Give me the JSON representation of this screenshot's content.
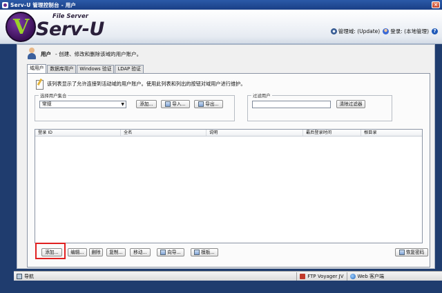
{
  "window": {
    "title": "Serv-U 管理控制台 - 用户",
    "close_label": "×"
  },
  "logo": {
    "product": "Serv-U",
    "tagline": "File Server"
  },
  "header_links": [
    {
      "label": "管理域: (Update)",
      "icon": "gear-icon"
    },
    {
      "label": "登录: (本地管理)",
      "icon": "user-icon"
    }
  ],
  "help_label": "?",
  "page": {
    "title": "用户",
    "description": "- 创建、修改和删除该域的用户账户。"
  },
  "tabs": [
    "域用户",
    "数据库用户",
    "Windows 验证",
    "LDAP 验证"
  ],
  "info_text": "该列表显示了允许连接到活动域的用户账户。使用此列表和列出的按钮对域用户进行维护。",
  "user_set": {
    "label": "选择用户集合",
    "selected": "常规",
    "add_label": "添加...",
    "import_label": "导入...",
    "export_label": "导出..."
  },
  "filter": {
    "label": "过滤用户",
    "value": "",
    "clear_label": "清除过滤器"
  },
  "table": {
    "columns": [
      "登录 ID",
      "全名",
      "说明",
      "最后登录时间",
      "根目录"
    ],
    "rows": []
  },
  "bottom_buttons": {
    "add": "添加...",
    "edit": "编辑...",
    "delete": "删除",
    "copy": "复制...",
    "move": "移动...",
    "wizard": "向导...",
    "template": "模板...",
    "restore_password": "恢复密码"
  },
  "statusbar": {
    "nav": "导航",
    "ftp": "FTP Voyager JV",
    "web": "Web 客户端"
  },
  "colors": {
    "highlight": "#e02020",
    "desktop": "#1f3c6e"
  }
}
